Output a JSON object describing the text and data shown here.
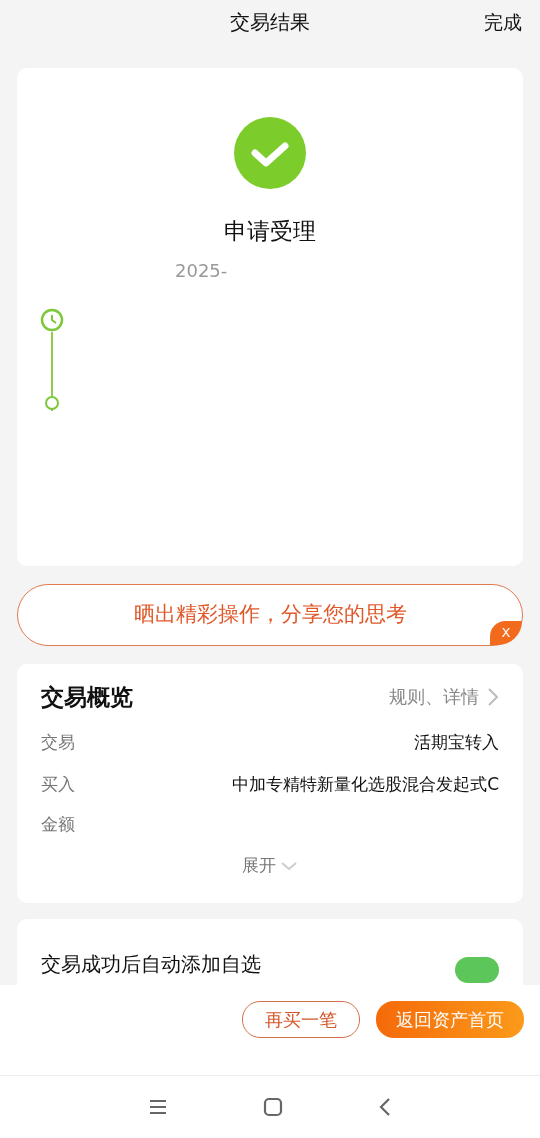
{
  "header": {
    "title": "交易结果",
    "action": "完成"
  },
  "result": {
    "status": "申请受理",
    "date": "2025-",
    "success": true
  },
  "timeline": [
    {
      "kind": "clock"
    },
    {
      "kind": "dot"
    }
  ],
  "share_banner": {
    "text": "晒出精彩操作，分享您的思考",
    "close_label": "X"
  },
  "overview": {
    "title": "交易概览",
    "link": "规则、详情",
    "rows": [
      {
        "label": "交易",
        "value": "活期宝转入"
      },
      {
        "label": "买入",
        "value": "中加专精特新量化选股混合发起式C"
      },
      {
        "label": "金额"
      }
    ],
    "expand": "展开"
  },
  "auto_add": {
    "label": "交易成功后自动添加自选",
    "on": true
  },
  "buttons": [
    {
      "label": "再买一笔",
      "kind": "outline"
    },
    {
      "label": "返回资产首页",
      "kind": "primary"
    }
  ]
}
